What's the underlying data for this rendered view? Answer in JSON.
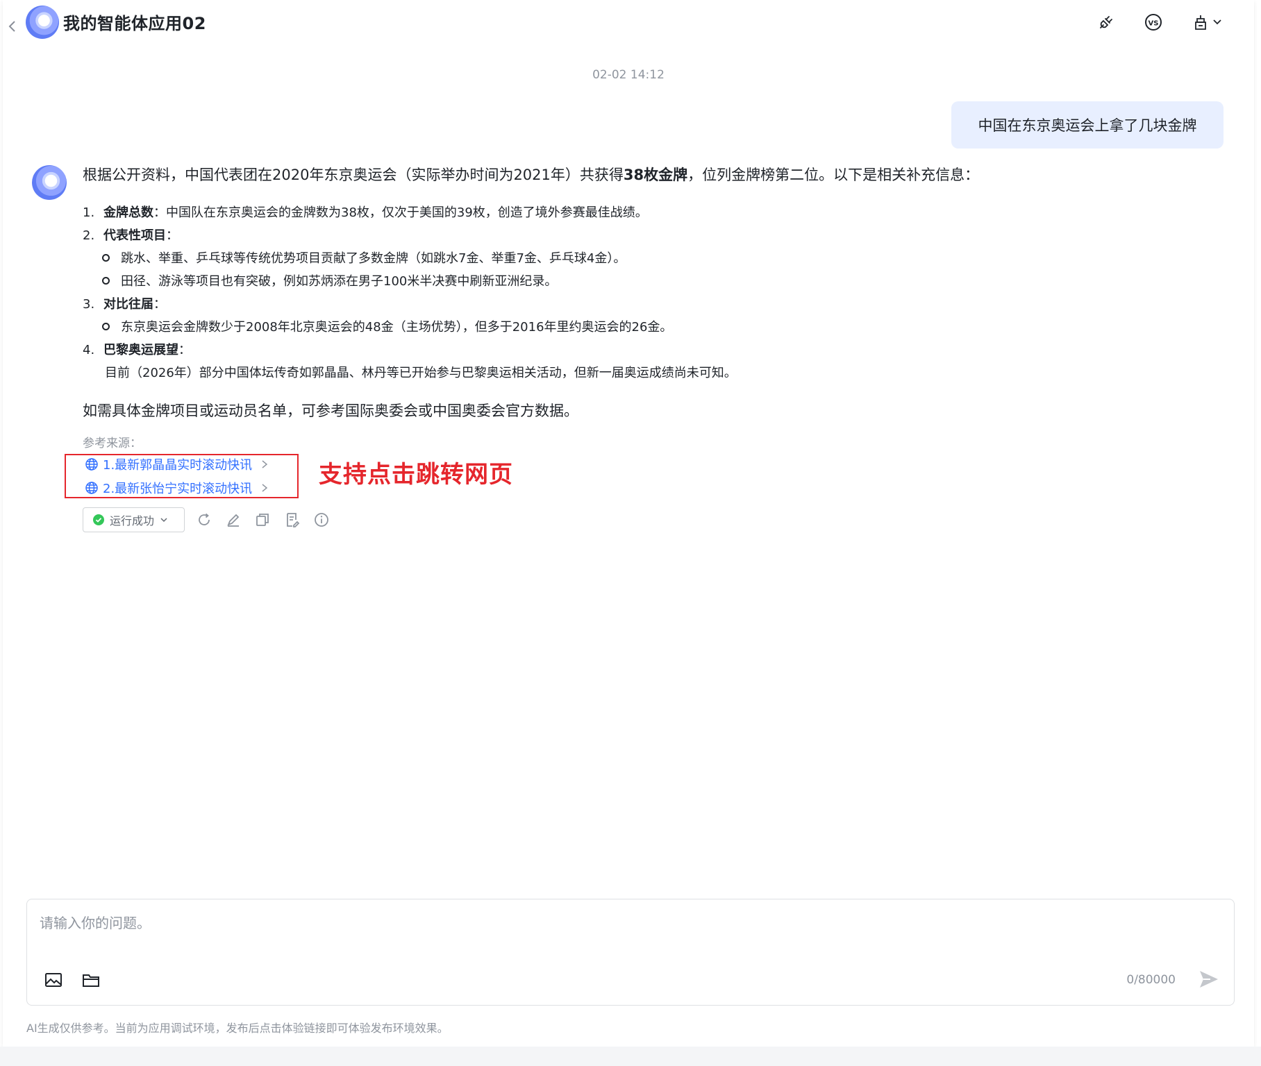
{
  "header": {
    "title": "我的智能体应用02",
    "icons": [
      "back-arrow-icon",
      "plug-icon",
      "vs-icon",
      "tools-icon",
      "chevron-down-icon"
    ]
  },
  "timestamp": "02-02 14:12",
  "user_message": "中国在东京奥运会上拿了几块金牌",
  "answer": {
    "intro_prefix": "根据公开资料，中国代表团在2020年东京奥运会（实际举办时间为2021年）共获得",
    "intro_bold": "38枚金牌",
    "intro_suffix": "，位列金牌榜第二位。以下是相关补充信息：",
    "items": [
      {
        "num": "1.",
        "title": "金牌总数",
        "text": "：中国队在东京奥运会的金牌数为38枚，仅次于美国的39枚，创造了境外参赛最佳战绩。"
      },
      {
        "num": "2.",
        "title": "代表性项目",
        "text": "："
      },
      {
        "bullet": "跳水、举重、乒乓球等传统优势项目贡献了多数金牌（如跳水7金、举重7金、乒乓球4金）。"
      },
      {
        "bullet": "田径、游泳等项目也有突破，例如苏炳添在男子100米半决赛中刷新亚洲纪录。"
      },
      {
        "num": "3.",
        "title": "对比往届",
        "text": "："
      },
      {
        "bullet": "东京奥运会金牌数少于2008年北京奥运会的48金（主场优势），但多于2016年里约奥运会的26金。"
      },
      {
        "num": "4.",
        "title": "巴黎奥运展望",
        "text": "："
      },
      {
        "plain": "目前（2026年）部分中国体坛传奇如郭晶晶、林丹等已开始参与巴黎奥运相关活动，但新一届奥运成绩尚未可知。"
      }
    ],
    "closing": "如需具体金牌项目或运动员名单，可参考国际奥委会或中国奥委会官方数据。"
  },
  "references": {
    "label": "参考来源：",
    "links": [
      "1.最新郭晶晶实时滚动快讯",
      "2.最新张怡宁实时滚动快讯"
    ]
  },
  "annotation": "支持点击跳转网页",
  "status": {
    "label": "运行成功",
    "color": "#34c759"
  },
  "input": {
    "placeholder": "请输入你的问题。",
    "value": "",
    "counter": "0/80000"
  },
  "footer_note": "AI生成仅供参考。当前为应用调试环境，发布后点击体验链接即可体验发布环境效果。",
  "colors": {
    "accent": "#3370ff",
    "annotation": "#e5262c",
    "bubble": "#e8efff"
  }
}
